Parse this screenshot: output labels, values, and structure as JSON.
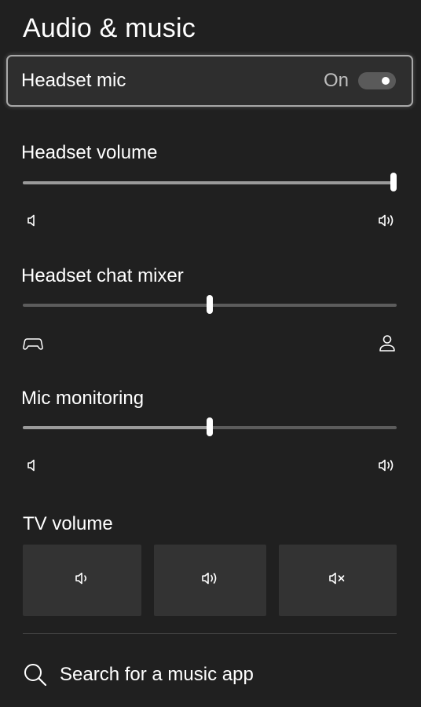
{
  "panel": {
    "title": "Audio & music"
  },
  "headset_mic": {
    "label": "Headset mic",
    "state": "On",
    "enabled": true
  },
  "headset_volume": {
    "label": "Headset volume",
    "value": 1.0,
    "low_icon": "speaker-low-icon",
    "high_icon": "speaker-high-icon"
  },
  "chat_mixer": {
    "label": "Headset chat mixer",
    "value": 0.5,
    "low_icon": "controller-icon",
    "high_icon": "person-icon"
  },
  "mic_monitoring": {
    "label": "Mic monitoring",
    "value": 0.5,
    "low_icon": "speaker-low-icon",
    "high_icon": "speaker-high-icon"
  },
  "tv_volume": {
    "label": "TV volume",
    "buttons": [
      "volume-down-icon",
      "volume-up-icon",
      "mute-icon"
    ]
  },
  "search": {
    "label": "Search for a music app",
    "icon": "search-icon"
  },
  "colors": {
    "background": "#202020",
    "track": "#5c5c5c",
    "fill": "#9a9a9a",
    "button": "#333333",
    "focus_border": "#a8a8a8"
  }
}
